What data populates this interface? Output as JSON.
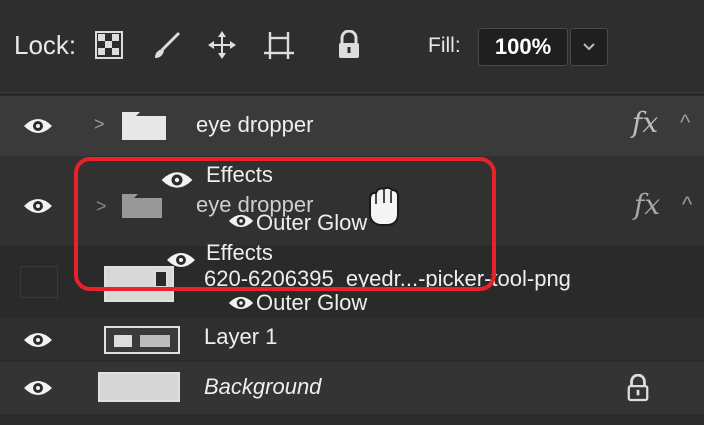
{
  "toolbar": {
    "lock_label": "Lock:",
    "fill_label": "Fill:",
    "fill_value": "100%",
    "lock_icons": [
      "checker-lock-icon",
      "brush-icon",
      "move-arrows-icon",
      "artboard-crop-icon",
      "padlock-icon"
    ]
  },
  "layers": {
    "eye_dropper_1": {
      "name": "eye dropper",
      "fx": "fx"
    },
    "ghost_effects": "Effects",
    "ghost_group": {
      "name": "eye dropper",
      "fx": "fx"
    },
    "ghost_outer_glow": "Outer Glow",
    "effects": "Effects",
    "png_layer": {
      "name": "620-6206395_eyedr...-picker-tool-png"
    },
    "outer_glow": "Outer Glow",
    "layer1": {
      "name": "Layer 1"
    },
    "background": {
      "name": "Background"
    }
  },
  "colors": {
    "highlight": "#e8212a",
    "panel": "#2b2b2b"
  }
}
